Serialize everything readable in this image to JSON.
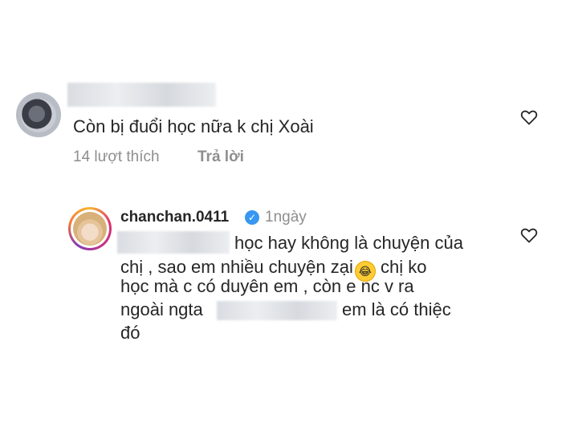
{
  "comment1": {
    "text": "Còn bị đuổi học nữa k chị Xoài",
    "likes": "14 lượt thích",
    "reply": "Trả lời"
  },
  "comment2": {
    "username": "chanchan.0411",
    "time": "1ngày",
    "lines": [
      "học hay không là chuyện của",
      "chị , sao em nhiều chuyện zại",
      "chị ko",
      "học mà c có duyên em , còn e nc v ra",
      "ngoài ngta",
      "em là có thiệc",
      "đó"
    ]
  },
  "icons": {
    "heart": "heart-icon",
    "verified": "verified-badge-icon",
    "emoji": "rofl-emoji-icon"
  },
  "colors": {
    "text": "#262626",
    "meta": "#8e8e8e",
    "verified": "#3897f0"
  }
}
